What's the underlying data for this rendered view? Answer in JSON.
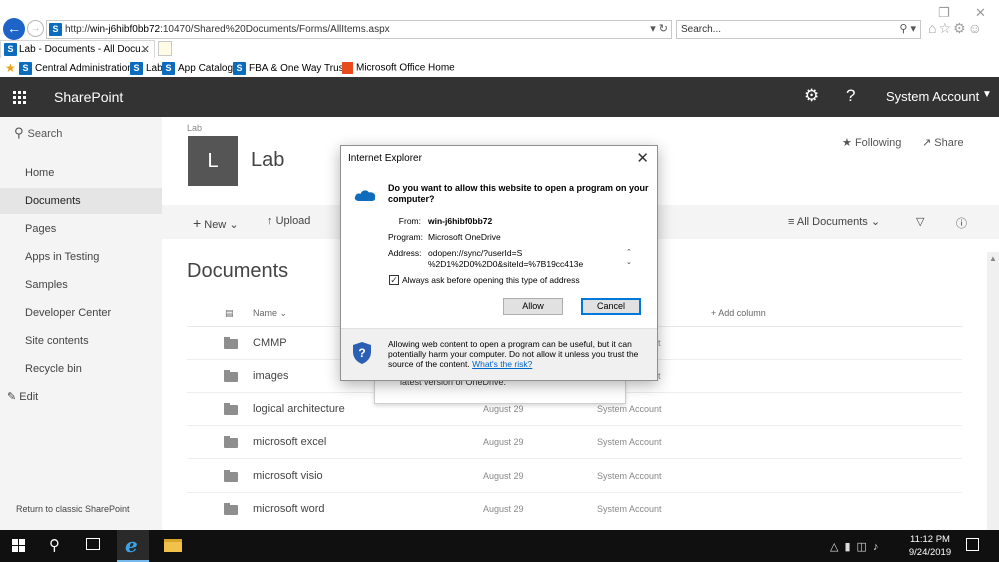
{
  "browser": {
    "url_prefix": "http://",
    "url_host": "win-j6hibf0bb72",
    "url_path": ":10470/Shared%20Documents/Forms/AllItems.aspx",
    "search_placeholder": "Search...",
    "tab_title": "Lab - Documents - All Docu...",
    "favorites": [
      "Central Administration",
      "Lab",
      "App Catalog",
      "FBA & One Way Trust",
      "Microsoft Office Home"
    ]
  },
  "suitebar": {
    "app_name": "SharePoint",
    "account": "System Account"
  },
  "leftnav": {
    "search_label": "Search",
    "items": [
      "Home",
      "Documents",
      "Pages",
      "Apps in Testing",
      "Samples",
      "Developer Center",
      "Site contents",
      "Recycle bin"
    ],
    "selected": "Documents",
    "edit_label": "Edit",
    "classic_link": "Return to classic SharePoint"
  },
  "site": {
    "breadcrumb": "Lab",
    "logo_letter": "L",
    "title": "Lab",
    "following_label": "Following",
    "share_label": "Share"
  },
  "commandbar": {
    "new_label": "New",
    "upload_label": "Upload",
    "view_label": "All Documents"
  },
  "library": {
    "title": "Documents",
    "columns": {
      "name": "Name",
      "add": "+ Add column"
    },
    "rows": [
      {
        "name": "CMMP",
        "modified": "",
        "modified_by": ""
      },
      {
        "name": "images",
        "modified": "",
        "modified_by": ""
      },
      {
        "name": "logical architecture",
        "modified": "August 29",
        "modified_by": "System Account"
      },
      {
        "name": "microsoft excel",
        "modified": "August 29",
        "modified_by": "System Account"
      },
      {
        "name": "microsoft visio",
        "modified": "August 29",
        "modified_by": "System Account"
      },
      {
        "name": "microsoft word",
        "modified": "August 29",
        "modified_by": "System Account"
      }
    ],
    "row_peek": [
      "nt",
      "nt"
    ]
  },
  "callout": {
    "text": "latest version of OneDrive."
  },
  "dialog": {
    "title": "Internet Explorer",
    "question": "Do you want to allow this website to open a program on your computer?",
    "from_label": "From:",
    "from_value": "win-j6hibf0bb72",
    "program_label": "Program:",
    "program_value": "Microsoft OneDrive",
    "address_label": "Address:",
    "address_line1": "odopen://sync/?userId=S",
    "address_line2": "%2D1%2D0%2D0&siteId=%7B19cc413e",
    "checkbox_label": "Always ask before opening this type of address",
    "checkbox_checked": true,
    "allow_label": "Allow",
    "cancel_label": "Cancel",
    "footer_text": "Allowing web content to open a program can be useful, but it can potentially harm your computer. Do not allow it unless you trust the source of the content.",
    "footer_link": "What's the risk?"
  },
  "taskbar": {
    "time": "11:12 PM",
    "date": "9/24/2019"
  }
}
